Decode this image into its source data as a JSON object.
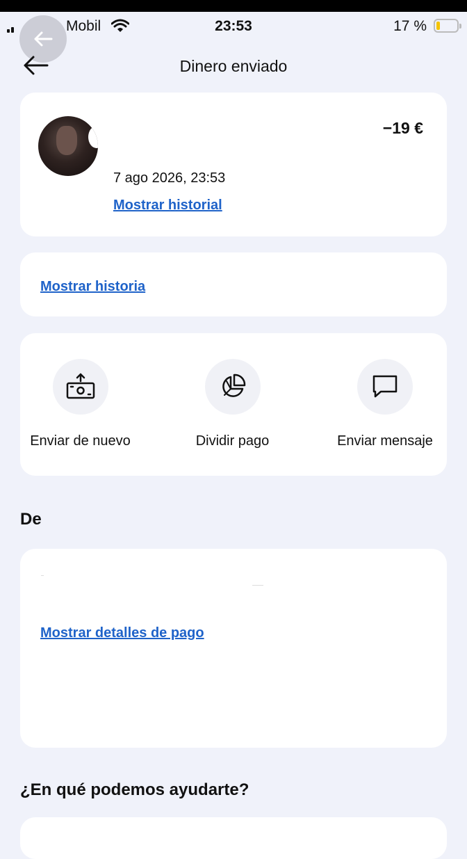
{
  "status_bar": {
    "carrier": "Mobil",
    "time": "23:53",
    "battery_percent": "17 %",
    "battery_level": 0.17,
    "battery_color": "#f5c400"
  },
  "header": {
    "title": "Dinero enviado",
    "back_icon": "arrow-left-icon"
  },
  "transaction": {
    "amount": "−19 €",
    "datetime": "7 ago 2026, 23:53",
    "history_link": "Mostrar historial"
  },
  "history_card": {
    "link": "Mostrar historia"
  },
  "actions": [
    {
      "label": "Enviar de nuevo",
      "icon": "banknote-upload-icon"
    },
    {
      "label": "Dividir pago",
      "icon": "pie-chart-icon"
    },
    {
      "label": "Enviar mensaje",
      "icon": "chat-bubble-icon"
    }
  ],
  "from_section": {
    "heading": "De",
    "details_link": "Mostrar detalles de pago"
  },
  "help_section": {
    "heading": "¿En qué podemos ayudarte?"
  },
  "colors": {
    "background": "#f0f2fa",
    "card": "#ffffff",
    "link": "#1f63c9"
  }
}
